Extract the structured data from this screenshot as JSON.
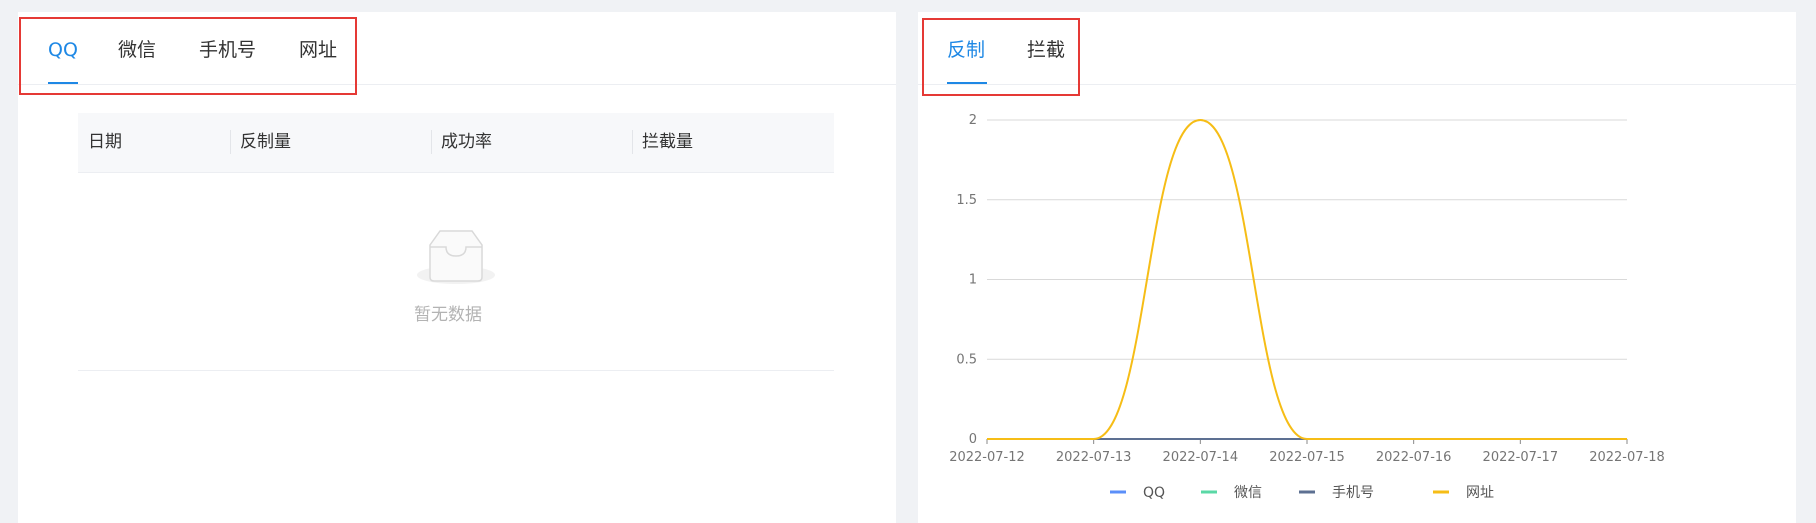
{
  "left_panel": {
    "tabs": [
      {
        "label": "QQ",
        "active": true
      },
      {
        "label": "微信",
        "active": false
      },
      {
        "label": "手机号",
        "active": false
      },
      {
        "label": "网址",
        "active": false
      }
    ],
    "table": {
      "columns": [
        "日期",
        "反制量",
        "成功率",
        "拦截量"
      ],
      "rows": [],
      "empty_text": "暂无数据"
    }
  },
  "right_panel": {
    "tabs": [
      {
        "label": "反制",
        "active": true
      },
      {
        "label": "拦截",
        "active": false
      }
    ]
  },
  "colors": {
    "accent": "#1e88e5",
    "highlight_box": "#e53935",
    "series_qq": "#5b8ff9",
    "series_wechat": "#5ad8a6",
    "series_phone": "#5d7092",
    "series_url": "#f6bd16"
  },
  "chart_data": {
    "type": "line",
    "smooth": true,
    "x": [
      "2022-07-12",
      "2022-07-13",
      "2022-07-14",
      "2022-07-15",
      "2022-07-16",
      "2022-07-17",
      "2022-07-18"
    ],
    "y_ticks": [
      "0",
      "0.5",
      "1",
      "1.5",
      "2"
    ],
    "ylim": [
      0,
      2
    ],
    "grid": true,
    "legend_position": "bottom",
    "series": [
      {
        "name": "QQ",
        "values": [
          0,
          0,
          0,
          0,
          0,
          0,
          0
        ]
      },
      {
        "name": "微信",
        "values": [
          0,
          0,
          0,
          0,
          0,
          0,
          0
        ]
      },
      {
        "name": "手机号",
        "values": [
          0,
          0,
          0,
          0,
          0,
          0,
          0
        ]
      },
      {
        "name": "网址",
        "values": [
          0,
          0,
          2,
          0,
          0,
          0,
          0
        ]
      }
    ]
  }
}
